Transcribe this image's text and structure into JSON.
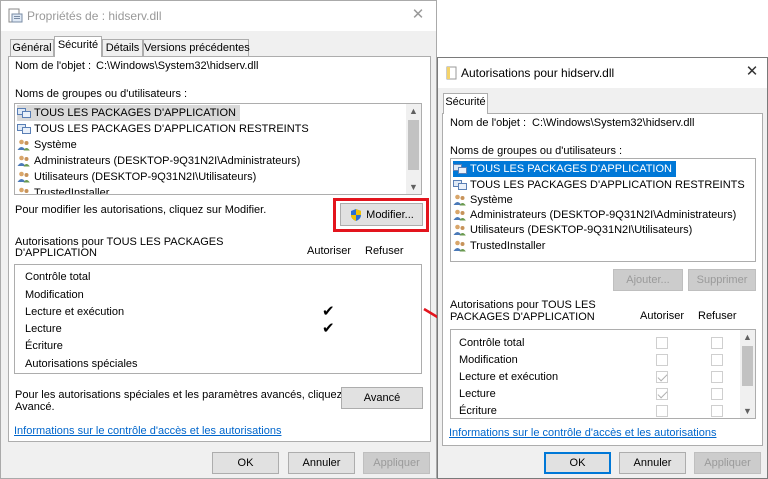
{
  "left_window": {
    "title": "Propriétés de : hidserv.dll",
    "tabs": [
      "Général",
      "Sécurité",
      "Détails",
      "Versions précédentes"
    ],
    "object_name_label": "Nom de l'objet :",
    "object_name_value": "C:\\Windows\\System32\\hidserv.dll",
    "groups_label": "Noms de groupes ou d'utilisateurs :",
    "users": [
      {
        "label": "TOUS LES PACKAGES D'APPLICATION",
        "icon": "group-icon"
      },
      {
        "label": "TOUS LES PACKAGES D'APPLICATION RESTREINTS",
        "icon": "group-icon"
      },
      {
        "label": "Système",
        "icon": "users-icon"
      },
      {
        "label": "Administrateurs (DESKTOP-9Q31N2I\\Administrateurs)",
        "icon": "users-icon"
      },
      {
        "label": "Utilisateurs (DESKTOP-9Q31N2I\\Utilisateurs)",
        "icon": "users-icon"
      },
      {
        "label": "TrustedInstaller",
        "icon": "users-icon"
      }
    ],
    "modify_hint": "Pour modifier les autorisations, cliquez sur Modifier.",
    "modify_button": "Modifier...",
    "perm_header_line1": "Autorisations pour TOUS LES PACKAGES",
    "perm_header_line2": "D'APPLICATION",
    "allow_col": "Autoriser",
    "deny_col": "Refuser",
    "permissions": [
      {
        "label": "Contrôle total",
        "allow": false,
        "deny": false
      },
      {
        "label": "Modification",
        "allow": false,
        "deny": false
      },
      {
        "label": "Lecture et exécution",
        "allow": true,
        "deny": false
      },
      {
        "label": "Lecture",
        "allow": true,
        "deny": false
      },
      {
        "label": "Écriture",
        "allow": false,
        "deny": false
      },
      {
        "label": "Autorisations spéciales",
        "allow": false,
        "deny": false
      }
    ],
    "advanced_hint_line1": "Pour les autorisations spéciales et les paramètres avancés, cliquez sur",
    "advanced_hint_line2": "Avancé.",
    "advanced_button": "Avancé",
    "info_link": "Informations sur le contrôle d'accès et les autorisations",
    "ok": "OK",
    "cancel": "Annuler",
    "apply": "Appliquer"
  },
  "right_window": {
    "title": "Autorisations pour hidserv.dll",
    "tab": "Sécurité",
    "object_name_label": "Nom de l'objet :",
    "object_name_value": "C:\\Windows\\System32\\hidserv.dll",
    "groups_label": "Noms de groupes ou d'utilisateurs :",
    "users": [
      {
        "label": "TOUS LES PACKAGES D'APPLICATION",
        "icon": "group-icon"
      },
      {
        "label": "TOUS LES PACKAGES D'APPLICATION RESTREINTS",
        "icon": "group-icon"
      },
      {
        "label": "Système",
        "icon": "users-icon"
      },
      {
        "label": "Administrateurs (DESKTOP-9Q31N2I\\Administrateurs)",
        "icon": "users-icon"
      },
      {
        "label": "Utilisateurs (DESKTOP-9Q31N2I\\Utilisateurs)",
        "icon": "users-icon"
      },
      {
        "label": "TrustedInstaller",
        "icon": "users-icon"
      }
    ],
    "add_button": "Ajouter...",
    "remove_button": "Supprimer",
    "perm_header_line1": "Autorisations pour TOUS LES",
    "perm_header_line2": "PACKAGES D'APPLICATION",
    "allow_col": "Autoriser",
    "deny_col": "Refuser",
    "permissions": [
      {
        "label": "Contrôle total",
        "allow": false,
        "deny": false
      },
      {
        "label": "Modification",
        "allow": false,
        "deny": false
      },
      {
        "label": "Lecture et exécution",
        "allow": true,
        "deny": false
      },
      {
        "label": "Lecture",
        "allow": true,
        "deny": false
      },
      {
        "label": "Écriture",
        "allow": false,
        "deny": false
      }
    ],
    "info_link": "Informations sur le contrôle d'accès et les autorisations",
    "ok": "OK",
    "cancel": "Annuler",
    "apply": "Appliquer"
  },
  "colors": {
    "highlight": "#0078d7",
    "annotation_red": "#e3141d",
    "link": "#0066cc"
  }
}
